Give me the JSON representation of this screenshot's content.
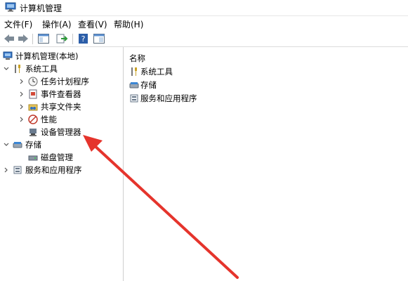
{
  "window": {
    "title": "计算机管理"
  },
  "menu": {
    "file": "文件(F)",
    "action": "操作(A)",
    "view": "查看(V)",
    "help": "帮助(H)"
  },
  "toolbar": {
    "buttons": [
      "back-icon",
      "forward-icon",
      "show-hide-tree-icon",
      "export-icon",
      "help-icon",
      "properties-icon"
    ]
  },
  "tree": {
    "root": "计算机管理(本地)",
    "system_tools": "系统工具",
    "task_scheduler": "任务计划程序",
    "event_viewer": "事件查看器",
    "shared_folders": "共享文件夹",
    "performance": "性能",
    "device_manager": "设备管理器",
    "storage": "存储",
    "disk_management": "磁盘管理",
    "services_apps": "服务和应用程序"
  },
  "list": {
    "column_name": "名称",
    "items": [
      "系统工具",
      "存储",
      "服务和应用程序"
    ]
  },
  "colors": {
    "annotation_arrow": "#e5342c"
  }
}
